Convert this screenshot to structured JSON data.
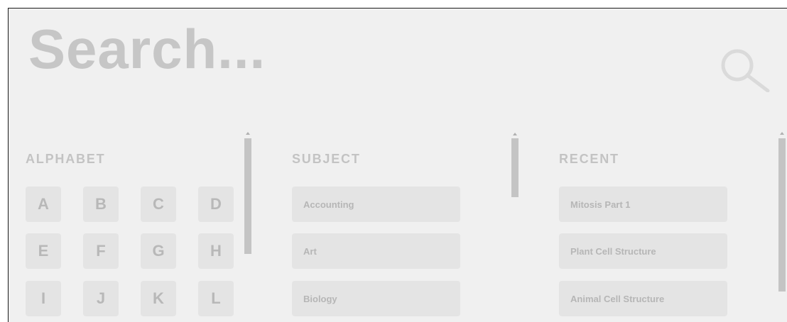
{
  "search": {
    "placeholder": "Search..."
  },
  "alphabet": {
    "heading": "ALPHABET",
    "letters": [
      "A",
      "B",
      "C",
      "D",
      "E",
      "F",
      "G",
      "H",
      "I",
      "J",
      "K",
      "L"
    ]
  },
  "subject": {
    "heading": "SUBJECT",
    "items": [
      "Accounting",
      "Art",
      "Biology"
    ]
  },
  "recent": {
    "heading": "RECENT",
    "items": [
      "Mitosis Part 1",
      "Plant Cell Structure",
      "Animal Cell Structure"
    ]
  }
}
